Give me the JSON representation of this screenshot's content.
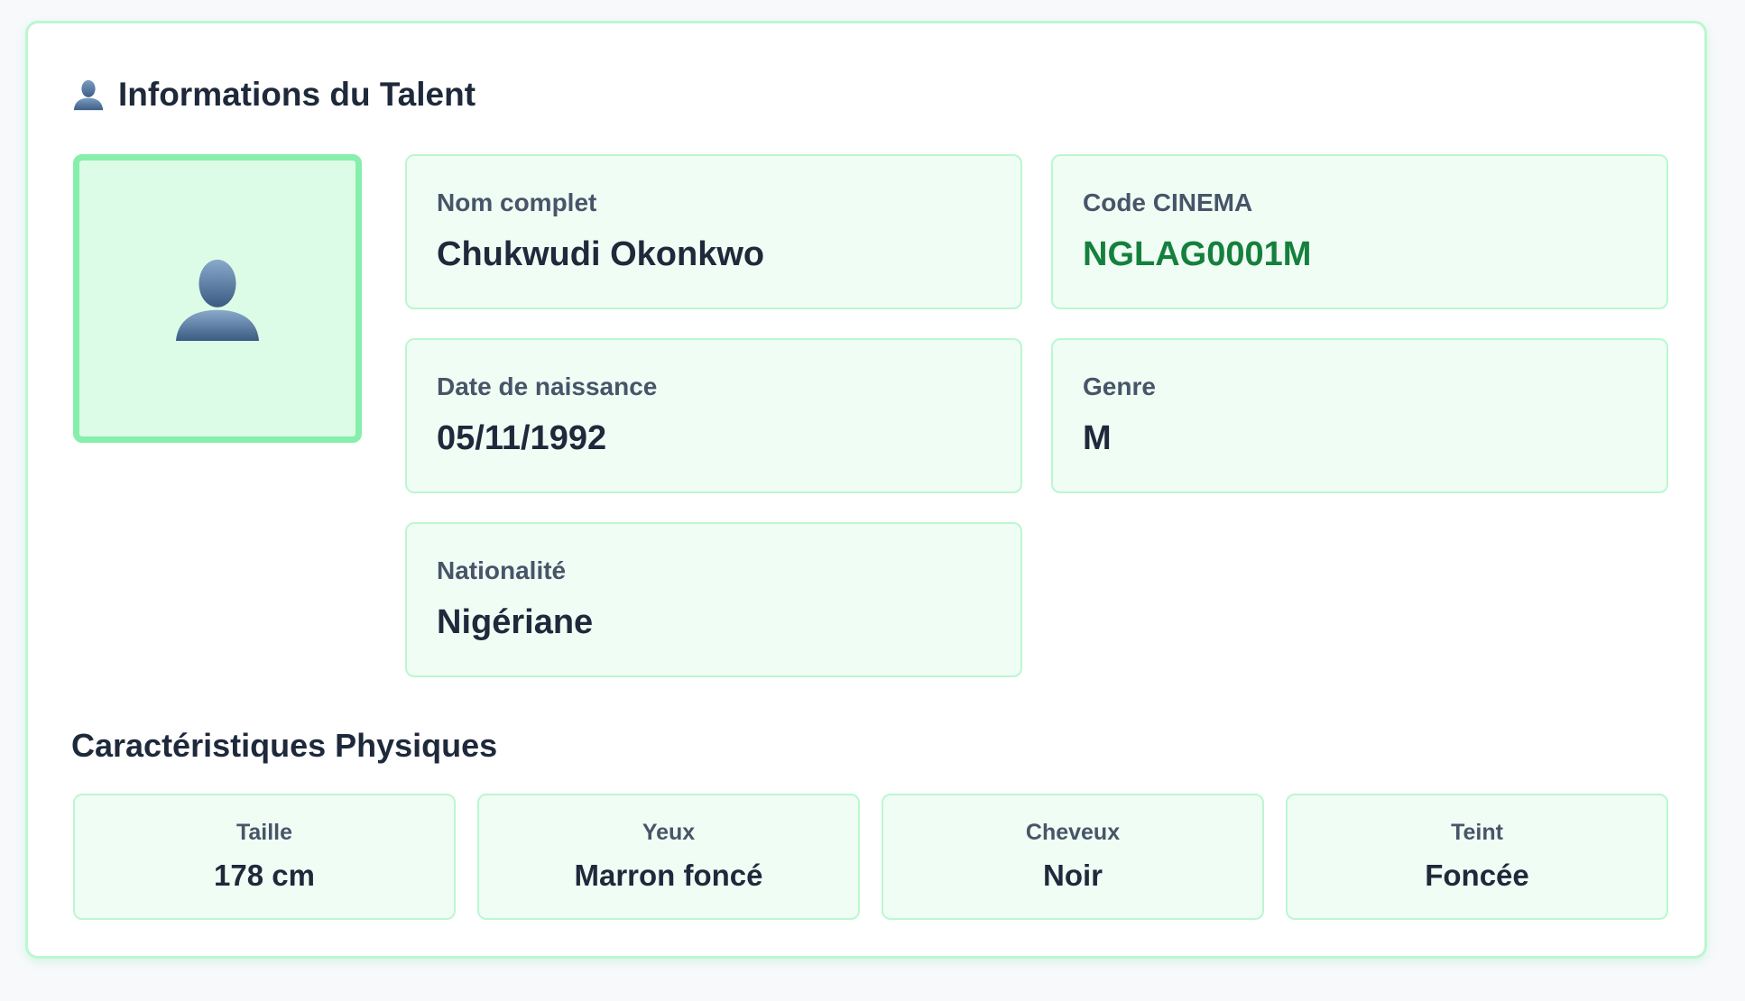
{
  "talent": {
    "section_title": "Informations du Talent",
    "fields": {
      "full_name": {
        "label": "Nom complet",
        "value": "Chukwudi Okonkwo"
      },
      "cinema_code": {
        "label": "Code CINEMA",
        "value": "NGLAG0001M"
      },
      "birth_date": {
        "label": "Date de naissance",
        "value": "05/11/1992"
      },
      "gender": {
        "label": "Genre",
        "value": "M"
      },
      "nationality": {
        "label": "Nationalité",
        "value": "Nigériane"
      }
    }
  },
  "physical": {
    "title": "Caractéristiques Physiques",
    "items": [
      {
        "label": "Taille",
        "value": "178 cm"
      },
      {
        "label": "Yeux",
        "value": "Marron foncé"
      },
      {
        "label": "Cheveux",
        "value": "Noir"
      },
      {
        "label": "Teint",
        "value": "Foncée"
      }
    ]
  },
  "icons": {
    "section": "person-silhouette-icon",
    "photo": "person-silhouette-icon"
  },
  "colors": {
    "accent_border": "#bbf7d0",
    "photo_border": "#86efac",
    "field_bg": "#f0fdf4",
    "code_text": "#15803d"
  }
}
